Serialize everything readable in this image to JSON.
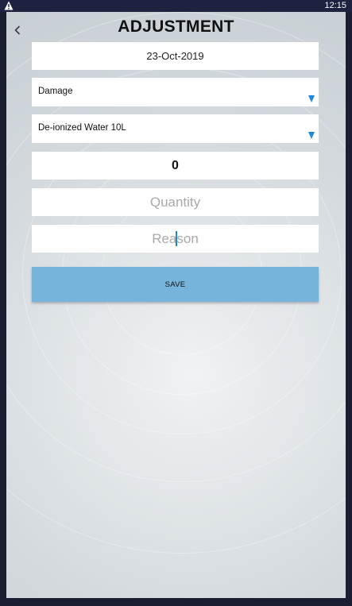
{
  "status_bar": {
    "time": "12:15",
    "warning_icon": "warning-triangle-icon"
  },
  "header": {
    "title": "ADJUSTMENT",
    "back_icon": "chevron-left-icon"
  },
  "form": {
    "date": "23-Oct-2019",
    "adjustment_type": "Damage",
    "product": "De-ionized Water 10L",
    "current_count": "0",
    "quantity_placeholder": "Quantity",
    "reason_placeholder": "Reason",
    "save_label": "SAVE"
  },
  "colors": {
    "accent": "#1e88d8",
    "save_button": "#77b4db",
    "status_bar": "#1e2240"
  }
}
